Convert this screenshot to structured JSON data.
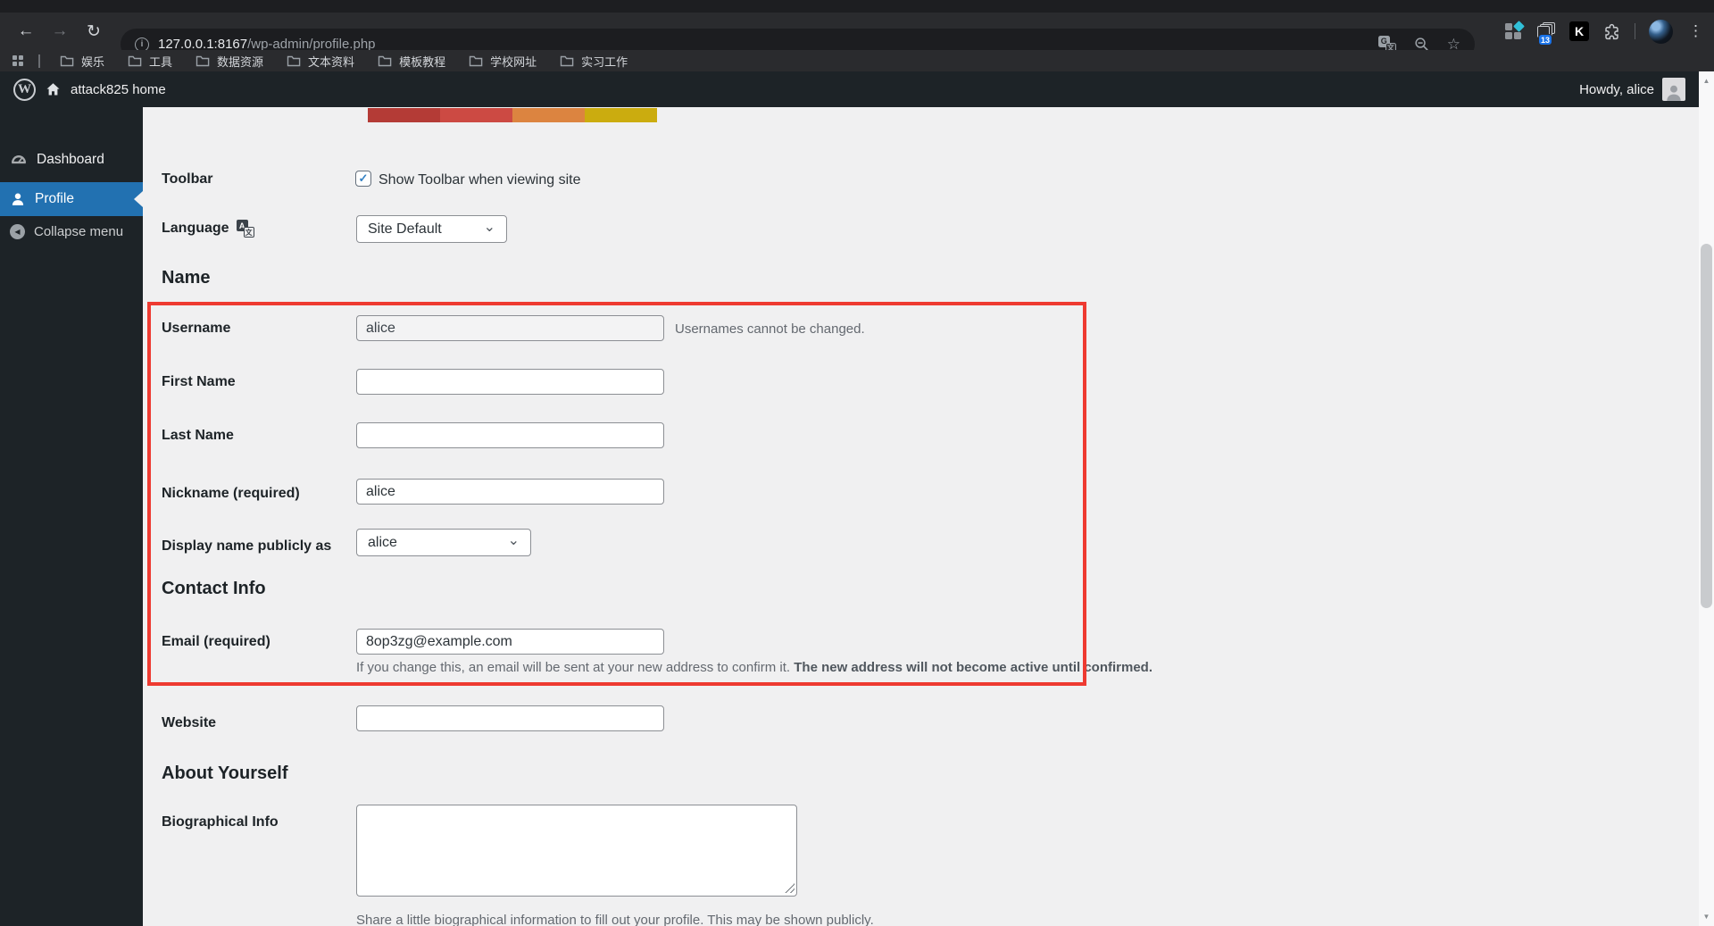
{
  "browser": {
    "url_host": "127.0.0.1:8167",
    "url_path": "/wp-admin/profile.php",
    "bookmarks": [
      "娱乐",
      "工具",
      "数据资源",
      "文本资料",
      "模板教程",
      "学校网址",
      "实习工作"
    ],
    "tab_stack_badge": "13",
    "ext_k_label": "K"
  },
  "icons": {
    "back": "←",
    "forward": "→",
    "reload": "↻",
    "star": "☆",
    "menu_dots": "⋮",
    "scroll_up": "▲",
    "scroll_down": "▼",
    "select_chevron": "⌄",
    "checkbox_check": "✓",
    "info": "i",
    "translate_g": "G",
    "translate_wen": "文",
    "translate_a": "A",
    "collapse_arrow": "◀",
    "wp_logo": "W"
  },
  "admin_bar": {
    "site_name": "attack825 home",
    "howdy": "Howdy, alice"
  },
  "sidebar": {
    "dashboard": "Dashboard",
    "profile": "Profile",
    "collapse": "Collapse menu"
  },
  "color_scheme_swatches": [
    "#b43b36",
    "#cc4a43",
    "#dc8440",
    "#cbac0f"
  ],
  "form": {
    "toolbar_label": "Toolbar",
    "toolbar_checkbox_label": "Show Toolbar when viewing site",
    "language_label": "Language",
    "language_value": "Site Default",
    "name_heading": "Name",
    "username_label": "Username",
    "username_value": "alice",
    "username_desc": "Usernames cannot be changed.",
    "first_name_label": "First Name",
    "first_name_value": "",
    "last_name_label": "Last Name",
    "last_name_value": "",
    "nickname_label": "Nickname (required)",
    "nickname_value": "alice",
    "display_name_label": "Display name publicly as",
    "display_name_value": "alice",
    "contact_heading": "Contact Info",
    "email_label": "Email (required)",
    "email_value": "8op3zg@example.com",
    "email_desc_normal": "If you change this, an email will be sent at your new address to confirm it. ",
    "email_desc_bold": "The new address will not become active until confirmed.",
    "website_label": "Website",
    "website_value": "",
    "about_heading": "About Yourself",
    "bio_label": "Biographical Info",
    "bio_desc": "Share a little biographical information to fill out your profile. This may be shown publicly."
  }
}
